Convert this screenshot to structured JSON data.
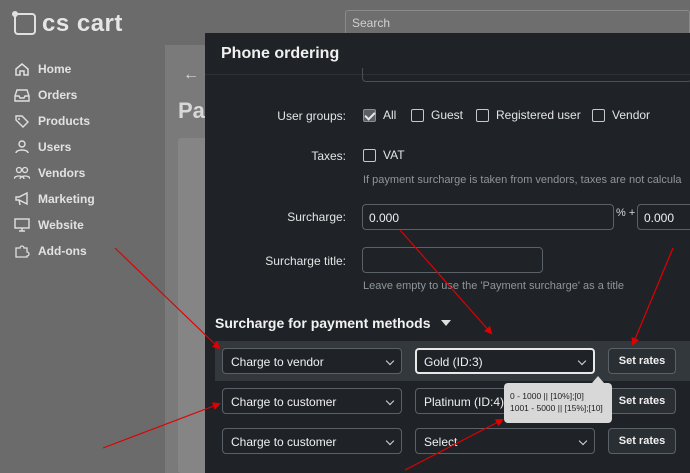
{
  "app": {
    "logo_text": "cs cart"
  },
  "search": {
    "placeholder": "Search"
  },
  "sidebar": {
    "items": [
      {
        "label": "Home",
        "icon": "home-icon"
      },
      {
        "label": "Orders",
        "icon": "inbox-icon"
      },
      {
        "label": "Products",
        "icon": "tag-icon"
      },
      {
        "label": "Users",
        "icon": "user-icon"
      },
      {
        "label": "Vendors",
        "icon": "vendors-icon"
      },
      {
        "label": "Marketing",
        "icon": "megaphone-icon"
      },
      {
        "label": "Website",
        "icon": "monitor-icon"
      },
      {
        "label": "Add-ons",
        "icon": "puzzle-icon"
      }
    ]
  },
  "background": {
    "heading_partial": "Pa",
    "back_arrow": "←"
  },
  "dialog": {
    "title": "Phone ordering",
    "user_groups": {
      "label": "User groups:",
      "options": [
        {
          "label": "All",
          "checked": true
        },
        {
          "label": "Guest",
          "checked": false
        },
        {
          "label": "Registered user",
          "checked": false
        },
        {
          "label": "Vendor",
          "checked": false
        }
      ]
    },
    "taxes": {
      "label": "Taxes:",
      "option": {
        "label": "VAT",
        "checked": false
      },
      "hint": "If payment surcharge is taken from vendors, taxes are not calcula"
    },
    "surcharge": {
      "label": "Surcharge:",
      "percent_value": "0.000",
      "percent_sign": "% +",
      "fixed_value": "0.000"
    },
    "surcharge_title": {
      "label": "Surcharge title:",
      "value": "",
      "hint": "Leave empty to use the 'Payment surcharge' as a title"
    },
    "section_title": "Surcharge for payment methods",
    "rows": [
      {
        "charge_to": "Charge to vendor",
        "plan": "Gold (ID:3)",
        "button": "Set rates",
        "highlighted": true
      },
      {
        "charge_to": "Charge to customer",
        "plan": "Platinum (ID:4)",
        "button": "Set rates",
        "highlighted": false
      },
      {
        "charge_to": "Charge to customer",
        "plan": "Select",
        "button": "Set rates",
        "highlighted": false
      }
    ],
    "tooltip": {
      "line1": "0 - 1000 || [10%];[0]",
      "line2": "1001 - 5000 || [15%];[10]"
    }
  },
  "colors": {
    "dialog_bg": "#1f2327",
    "highlight_row": "#33383d",
    "annotation_arrow": "#e00000",
    "tooltip_bg": "#d8d8d8"
  }
}
